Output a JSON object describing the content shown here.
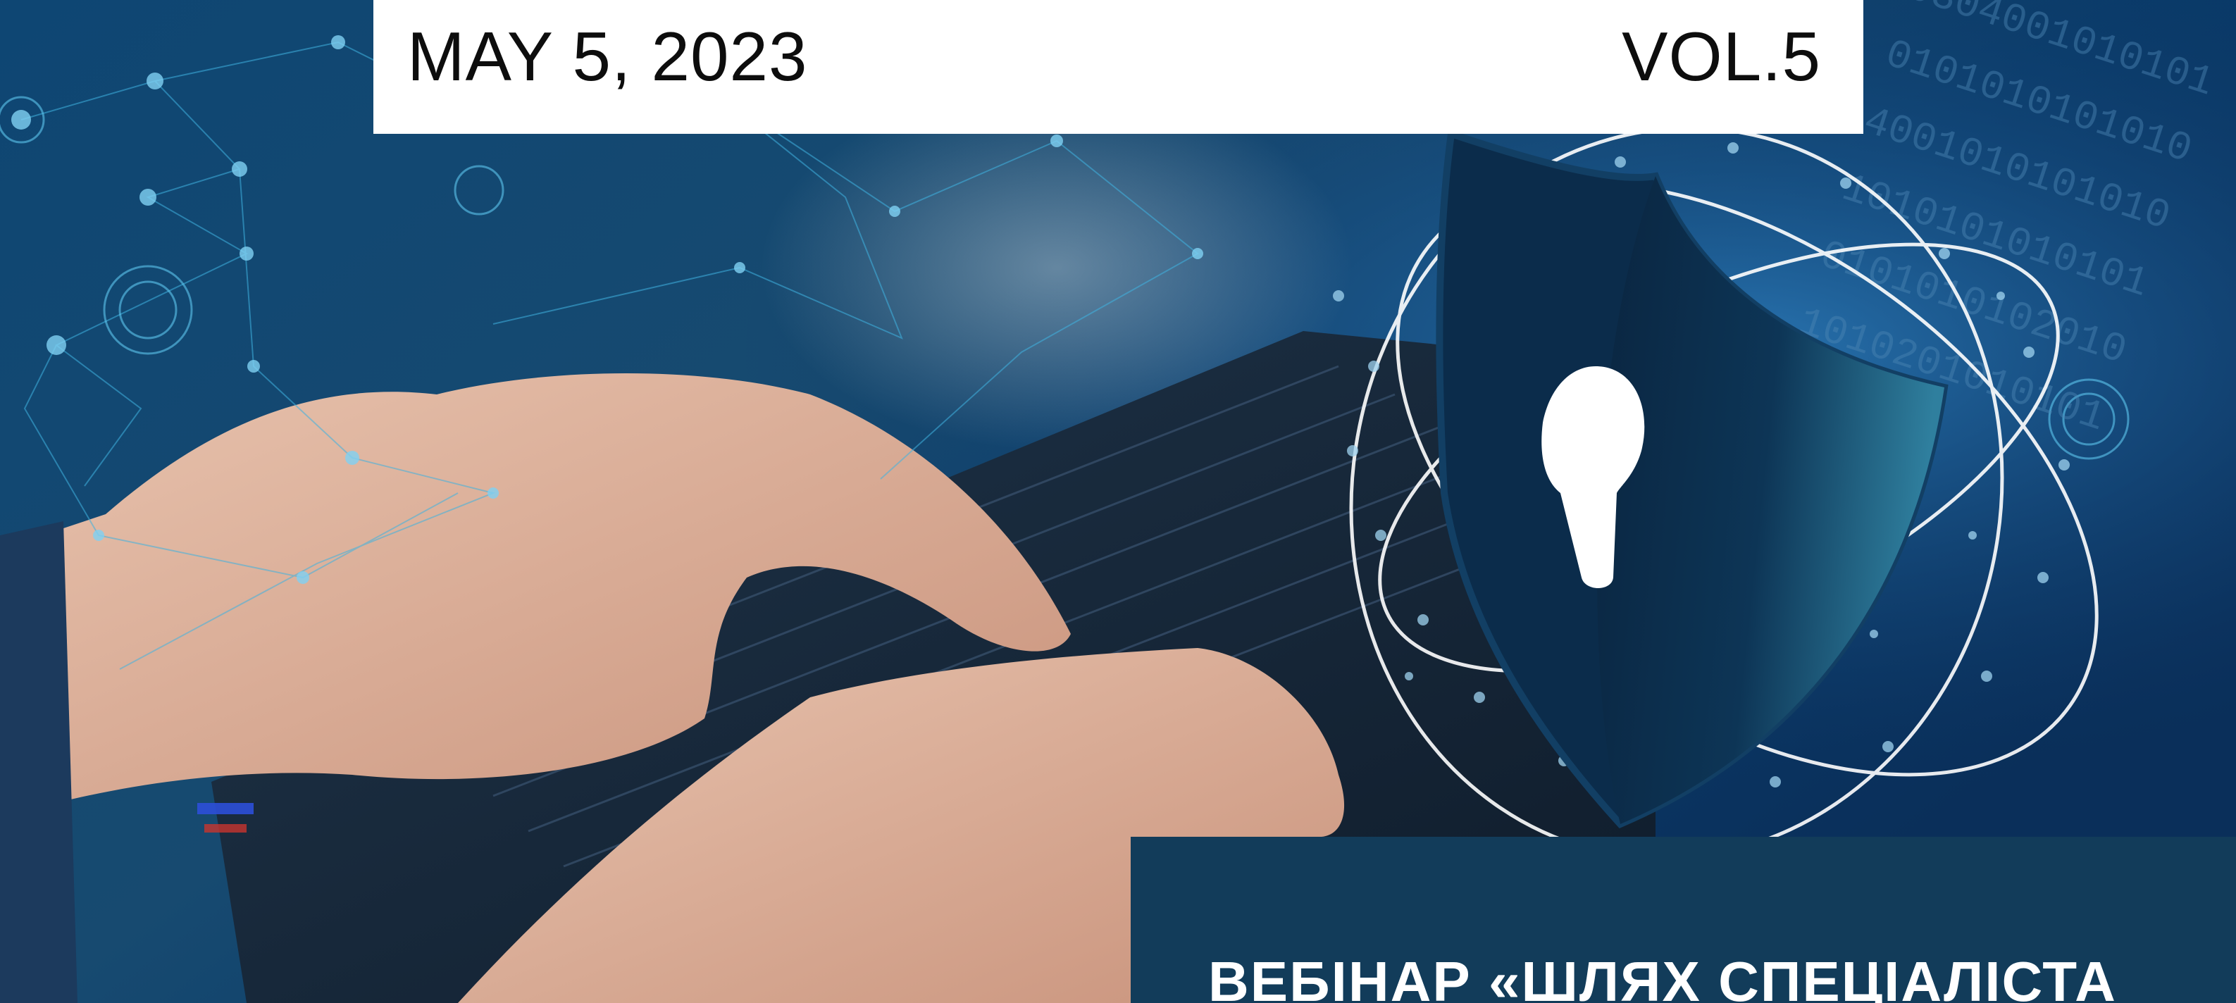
{
  "header": {
    "date": "MAY 5, 2023",
    "volume": "VOL.5"
  },
  "title_panel": {
    "title_partial": "ВЕБІНАР «ШЛЯХ СПЕЦІАЛІСТА"
  },
  "colors": {
    "background_blue": "#0b3a63",
    "header_bar": "#ffffff",
    "title_panel": "#123c5a",
    "shield_dark": "#0a2a45",
    "shield_light": "#2f7f9e"
  },
  "icons": [
    "shield-keyhole-icon",
    "network-node-icon"
  ]
}
